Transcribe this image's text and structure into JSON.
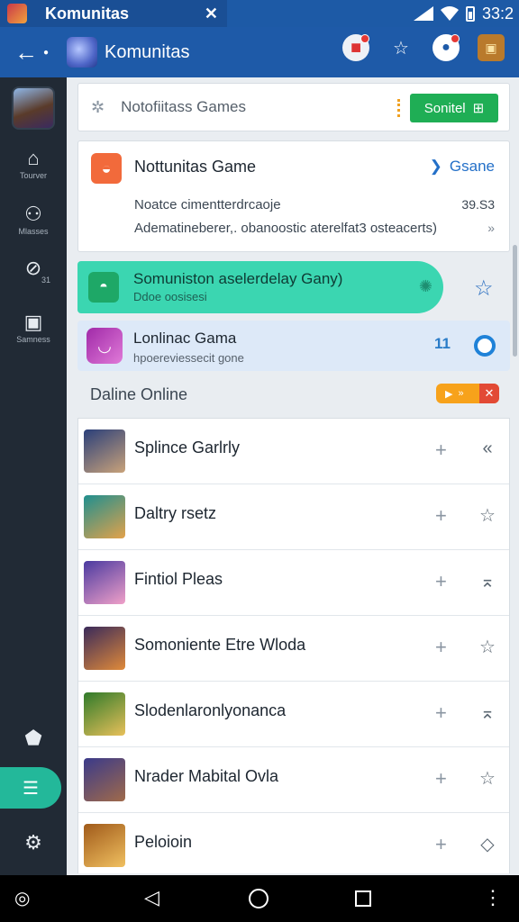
{
  "status_bar": {
    "tab_title": "Komunitas",
    "time": "33:2"
  },
  "app_bar": {
    "title": "Komunitas"
  },
  "sidebar": {
    "items": [
      {
        "icon": "home-icon",
        "label": "Tourver"
      },
      {
        "icon": "profile-icon",
        "label": "Mlasses"
      },
      {
        "icon": "explore-icon",
        "label": "31"
      },
      {
        "icon": "controller-icon",
        "label": "Samness"
      }
    ]
  },
  "search": {
    "placeholder": "Notofiitass Games",
    "button_label": "Sonitel"
  },
  "featured": {
    "title": "Nottunitas Game",
    "link_label": "Gsane",
    "row1_text": "Noatce cimentterdrcaoje",
    "row1_value": "39.S3",
    "row2_text": "Adematineberer,. obanoostic aterelfat3 osteacerts)",
    "row2_value": "»"
  },
  "highlight_green": {
    "title": "Somuniston aselerdelay Gany)",
    "subtitle": "Ddoe oosisesi"
  },
  "highlight_blue": {
    "title": "Lonlinac Gama",
    "subtitle": "hpoereviessecit gone",
    "value": "11"
  },
  "section": {
    "title": "Daline Online"
  },
  "games": [
    {
      "name": "Splince Garlrly",
      "action_icon": "chevron-left-icon",
      "avatar_colors": [
        "#2a3f7a",
        "#c9a27a"
      ]
    },
    {
      "name": "Daltry rsetz",
      "action_icon": "star-icon",
      "avatar_colors": [
        "#1f8f8f",
        "#e3a24a"
      ]
    },
    {
      "name": "Fintiol Pleas",
      "action_icon": "collapse-icon",
      "avatar_colors": [
        "#4a3aa0",
        "#f0a0c8"
      ]
    },
    {
      "name": "Somoniente Etre Wloda",
      "action_icon": "star-icon",
      "avatar_colors": [
        "#3a2a5a",
        "#e08a3a"
      ]
    },
    {
      "name": "Slodenlaronlyonanca",
      "action_icon": "collapse-icon",
      "avatar_colors": [
        "#2f7a2a",
        "#e8c05a"
      ]
    },
    {
      "name": "Nrader Mabital Ovla",
      "action_icon": "star-icon",
      "avatar_colors": [
        "#3a3a8a",
        "#a06a4a"
      ]
    },
    {
      "name": "Peloioin",
      "action_icon": "diamond-icon",
      "avatar_colors": [
        "#a05a1a",
        "#f0c060"
      ]
    }
  ],
  "colors": {
    "app_bar": "#1e5aa8",
    "sidebar": "#212a35",
    "accent_green": "#3bd6b1",
    "button_green": "#1fae55",
    "active_nav": "#23b89a"
  }
}
